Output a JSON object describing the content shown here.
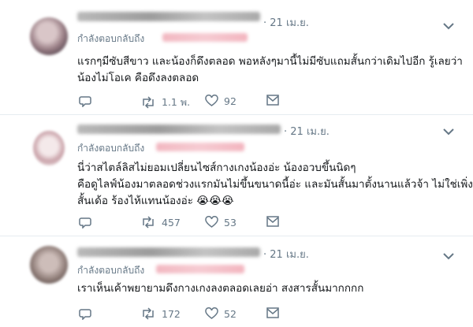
{
  "tweets": [
    {
      "time": "· 21 เม.ย.",
      "reply_label": "กำลังตอบกลับถึง",
      "lines": [
        "แรกๆมีซับสีขาว และน้องก็ดึงตลอด พอหลังๆมานี้ไม่มีซับแถมสั้นกว่าเดิมไปอีก รู้เลยว่า",
        "น้องไม่โอเค คือดึงลงตลอด"
      ],
      "retweets": "1.1 พ.",
      "likes": "92"
    },
    {
      "time": "· 21 เม.ย.",
      "reply_label": "กำลังตอบกลับถึง",
      "lines": [
        "นี่ว่าสไตล์ลิสไม่ยอมเปลี่ยนไซส์กางเกงน้องอ่ะ น้องอวบขึ้นนิดๆ",
        "คือดูไลฟ์น้องมาตลอดช่วงแรกมันไม่ขึ้นขนาดนี้อ่ะ และมันสั้นมาตั้งนานแล้วจ้า ไม่ใช่เพิ่งมา",
        "สั้นเด้อ  ร้องไห้แทนน้องอ่ะ 😭😭😭"
      ],
      "retweets": "457",
      "likes": "53"
    },
    {
      "time": "· 21 เม.ย.",
      "reply_label": "กำลังตอบกลับถึง",
      "lines": [
        "เราเห็นเค้าพยายามดึงกางเกงลงตลอดเลยอ่า สงสารสั้นมากกกก"
      ],
      "retweets": "172",
      "likes": "52"
    }
  ]
}
